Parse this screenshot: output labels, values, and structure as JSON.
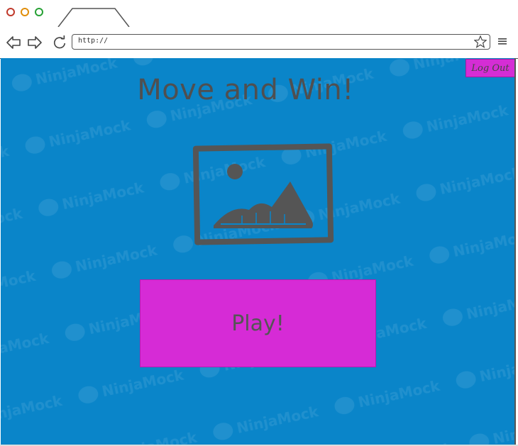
{
  "browser": {
    "url": "http://",
    "watermark_text": "NinjaMock"
  },
  "page": {
    "title": "Move and Win!",
    "logout_label": "Log Out",
    "play_label": "Play!"
  },
  "colors": {
    "page_background": "#0a85c9",
    "button_magenta": "#d62bd6",
    "text_gray": "#4f4f50"
  },
  "icons": {
    "back": "arrow-left-icon",
    "forward": "arrow-right-icon",
    "reload": "reload-icon",
    "bookmark": "star-icon",
    "menu": "hamburger-menu-icon",
    "image": "image-placeholder-icon"
  }
}
